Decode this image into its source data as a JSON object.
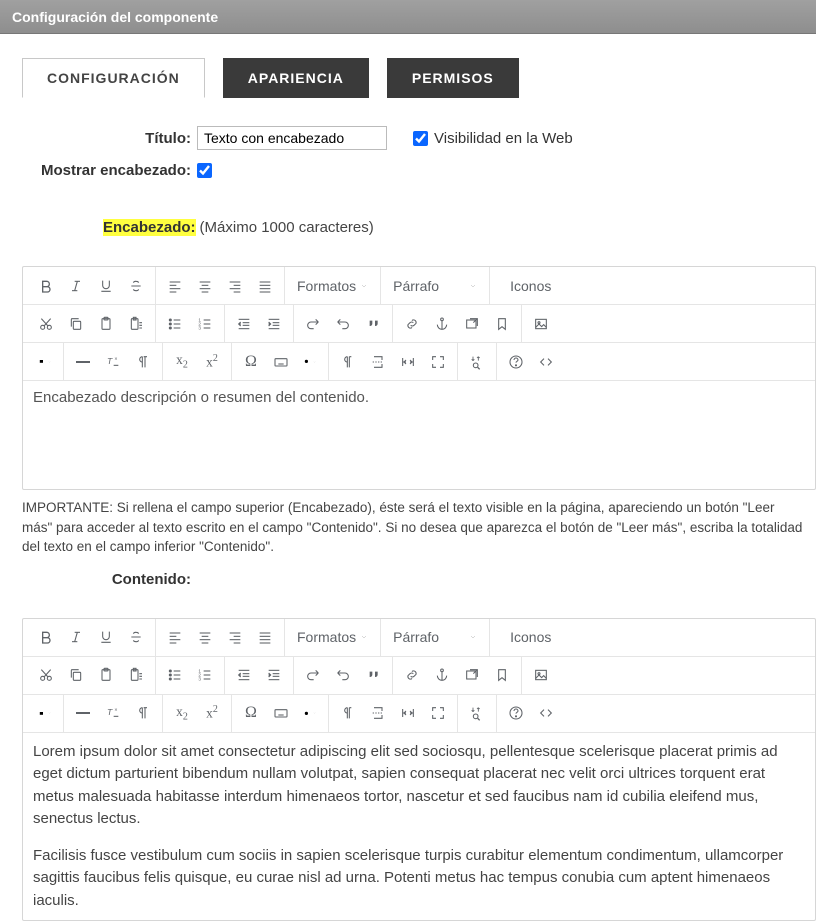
{
  "window": {
    "title": "Configuración del componente"
  },
  "tabs": [
    {
      "label": "CONFIGURACIÓN",
      "active": true
    },
    {
      "label": "APARIENCIA",
      "active": false
    },
    {
      "label": "PERMISOS",
      "active": false
    }
  ],
  "form": {
    "title_label": "Título:",
    "title_value": "Texto con encabezado",
    "visibility_label": "Visibilidad en la Web",
    "show_header_label": "Mostrar encabezado:",
    "header_label": "Encabezado:",
    "header_note": "(Máximo 1000 caracteres)",
    "content_label": "Contenido:"
  },
  "toolbar": {
    "formats": "Formatos",
    "paragraph": "Párrafo",
    "icons": "Iconos"
  },
  "editor1": {
    "content": "Encabezado descripción o resumen del contenido."
  },
  "editor2": {
    "p1": "Lorem ipsum dolor sit amet consectetur adipiscing elit sed sociosqu, pellentesque scelerisque placerat primis ad eget dictum parturient bibendum nullam volutpat, sapien consequat placerat nec velit orci ultrices torquent erat metus malesuada habitasse interdum himenaeos tortor, nascetur et sed faucibus nam id cubilia eleifend mus, senectus lectus.",
    "p2": "Facilisis fusce vestibulum cum sociis in sapien scelerisque turpis curabitur elementum condimentum, ullamcorper sagittis faucibus felis quisque, eu curae nisl ad urna. Potenti metus hac tempus conubia cum aptent himenaeos iaculis."
  },
  "help_text": "IMPORTANTE: Si rellena el campo superior (Encabezado), éste será el texto visible en la página, apareciendo un botón \"Leer más\" para acceder al texto escrito en el campo \"Contenido\". Si no desea que aparezca el botón de \"Leer más\", escriba la totalidad del texto en el campo inferior \"Contenido\"."
}
